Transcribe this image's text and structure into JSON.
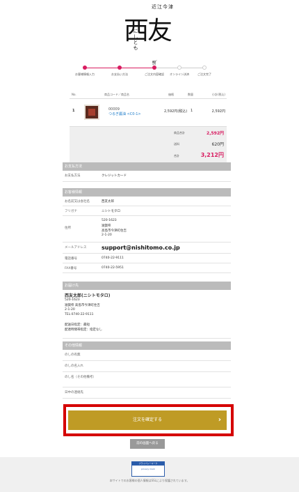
{
  "logo": {
    "top": "近江今津",
    "main": "西友",
    "side": "にしとも"
  },
  "steps": [
    {
      "label": "お客様情報入力"
    },
    {
      "label": "お支払い方法"
    },
    {
      "label": "ご注文内容確認"
    },
    {
      "label": "オンライン決済"
    },
    {
      "label": "ご注文完了"
    }
  ],
  "order": {
    "headers": {
      "no": "No.",
      "product": "商品コード／商品名",
      "price": "価格",
      "qty": "数量",
      "subtotal": "小計(税込)"
    },
    "item": {
      "no": "1",
      "code": "00009",
      "name": "つるぎ醤油 <C0-1>",
      "unit_price": "2,592円(税込)",
      "qty": "1",
      "subtotal": "2,592円"
    },
    "summary": [
      {
        "label": "商品合計",
        "value": "2,592円"
      },
      {
        "label": "送料",
        "value": "620円"
      },
      {
        "label": "合計",
        "value": "3,212円"
      }
    ]
  },
  "payment": {
    "title": "お支払方法",
    "label": "お支払方法",
    "value": "クレジットカード"
  },
  "customer": {
    "title": "お客様情報",
    "name_label": "お名前又は会社名",
    "name": "西友太郎",
    "kana_label": "フリガナ",
    "kana": "ニシトモタロ",
    "addr_label": "住所",
    "postal": "520-1623",
    "addr1": "滋賀県",
    "addr2": "高島市今津町住吉",
    "addr3": "2-1-20",
    "email_label": "メールアドレス",
    "email": "support@nishitomo.co.jp",
    "tel_label": "電話番号",
    "tel": "0740-22-9111",
    "fax_label": "FAX番号",
    "fax": "0740-22-5951"
  },
  "delivery": {
    "title": "お届け先",
    "name": "西友太郎(ニシトモタロ)",
    "postal": "520-1623",
    "address": "滋賀県 高島市今津町住吉",
    "address2": "2-1-20",
    "tel": "TEL:0740-22-9111",
    "date": "配送日指定：最短",
    "time": "配達時間帯指定：指定なし"
  },
  "other": {
    "title": "その他情報",
    "fields": [
      {
        "label": "のしの有無"
      },
      {
        "label": "のしの名入れ"
      },
      {
        "label": "のし名（その他備考）"
      },
      {
        "label": "日中の連絡先"
      }
    ]
  },
  "buttons": {
    "confirm": "注文を確定する",
    "confirm_arrow": "›",
    "back": "前の画面へ戻る"
  },
  "footer": {
    "badge_title": "プライバシーマーク",
    "badge_text": "privacy mark",
    "note": "本サイトでのお客様の個人情報はSSLにより保護されています。"
  },
  "icons": {
    "cart": "cart-icon"
  }
}
